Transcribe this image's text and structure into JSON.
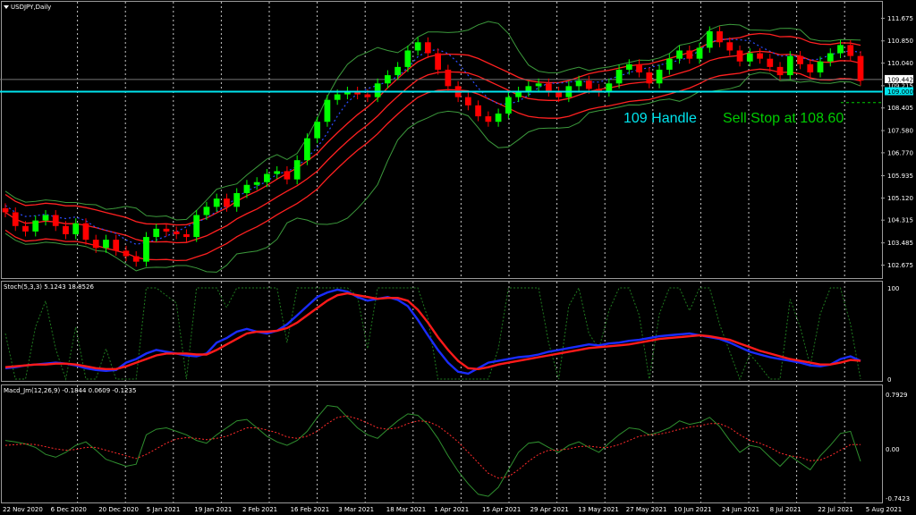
{
  "chart_data": [
    {
      "type": "line",
      "panel": "main",
      "title": "USDJPY,Daily",
      "x_labels": [
        "22 Nov 2020",
        "6 Dec 2020",
        "20 Dec 2020",
        "5 Jan 2021",
        "19 Jan 2021",
        "2 Feb 2021",
        "16 Feb 2021",
        "3 Mar 2021",
        "18 Mar 2021",
        "1 Apr 2021",
        "15 Apr 2021",
        "29 Apr 2021",
        "13 May 2021",
        "27 May 2021",
        "10 Jun 2021",
        "24 Jun 2021",
        "8 Jul 2021",
        "22 Jul 2021",
        "5 Aug 2021"
      ],
      "y_ticks": [
        102.675,
        103.485,
        104.315,
        105.12,
        105.935,
        106.77,
        107.58,
        108.405,
        109.215,
        110.04,
        110.85,
        111.675
      ],
      "ylim": [
        102.3,
        111.95
      ],
      "grid": true,
      "price_labels": {
        "current": "109.442",
        "level": "109.000"
      },
      "level_line": 109.0,
      "stop_line": 108.6,
      "annotations": {
        "handle": "109 Handle",
        "stop": "Sell Stop at 108.60"
      },
      "colors": {
        "up": "#00ff00",
        "down": "#ff0000",
        "level": "#00e5ee",
        "stop": "#00cc00",
        "bands": "#3c9a3c",
        "envelope": "#ff2020",
        "dots": "#2b4cff"
      },
      "series": [
        {
          "values": [
            104.6,
            104.1,
            103.9,
            104.3,
            104.5,
            104.1,
            103.8,
            104.2,
            103.6,
            103.3,
            103.6,
            103.2,
            103.0,
            102.8,
            103.7,
            104.0,
            103.9,
            103.8,
            103.7,
            104.5,
            104.8,
            105.1,
            104.8,
            105.3,
            105.6,
            105.7,
            106.0,
            106.1,
            105.8,
            106.5,
            107.3,
            107.9,
            108.7,
            108.9,
            109.0,
            108.9,
            108.8,
            109.3,
            109.6,
            109.9,
            110.5,
            110.8,
            110.4,
            109.8,
            109.2,
            108.8,
            108.5,
            108.1,
            107.9,
            108.2,
            108.8,
            109.0,
            109.2,
            109.3,
            109.0,
            108.8,
            109.2,
            109.4,
            109.1,
            109.0,
            109.3,
            109.8,
            110.0,
            109.7,
            109.3,
            109.8,
            110.2,
            110.5,
            110.2,
            110.6,
            111.2,
            110.8,
            110.5,
            110.1,
            110.4,
            110.2,
            109.9,
            109.6,
            110.3,
            110.0,
            109.7,
            110.1,
            110.4,
            110.7,
            110.3,
            109.4
          ]
        }
      ]
    },
    {
      "type": "line",
      "panel": "stochastic",
      "title": "Stoch(5,3,3) 5.1243 18.8526",
      "y_ticks": [
        100,
        0
      ],
      "ylim": [
        0,
        100
      ],
      "series": [
        {
          "values": [
            12,
            13,
            15,
            16,
            17,
            18,
            17,
            15,
            12,
            10,
            9,
            10,
            18,
            22,
            28,
            32,
            30,
            28,
            26,
            25,
            28,
            40,
            45,
            52,
            55,
            52,
            50,
            53,
            60,
            70,
            80,
            90,
            95,
            98,
            96,
            90,
            86,
            88,
            90,
            87,
            80,
            65,
            48,
            32,
            18,
            8,
            6,
            12,
            18,
            20,
            22,
            24,
            25,
            27,
            30,
            32,
            34,
            36,
            38,
            37,
            39,
            40,
            42,
            43,
            45,
            47,
            48,
            49,
            50,
            48,
            46,
            44,
            40,
            35,
            30,
            27,
            24,
            22,
            20,
            18,
            15,
            14,
            16,
            22,
            25,
            20
          ]
        },
        {
          "values": [
            13,
            14,
            15,
            16,
            16,
            17,
            17,
            16,
            14,
            12,
            11,
            11,
            14,
            18,
            22,
            26,
            28,
            28,
            28,
            27,
            27,
            32,
            38,
            44,
            50,
            52,
            52,
            53,
            56,
            62,
            70,
            78,
            86,
            92,
            94,
            92,
            90,
            88,
            89,
            89,
            86,
            76,
            62,
            46,
            32,
            20,
            12,
            11,
            13,
            16,
            18,
            20,
            22,
            24,
            26,
            28,
            30,
            32,
            34,
            35,
            36,
            37,
            38,
            40,
            42,
            44,
            45,
            46,
            47,
            48,
            47,
            45,
            43,
            39,
            35,
            31,
            28,
            25,
            22,
            20,
            18,
            16,
            16,
            18,
            21,
            20
          ]
        }
      ]
    },
    {
      "type": "line",
      "panel": "macd",
      "title": "Macd_Jm(12,26,9) -0.1844 0.0609 -0.1235",
      "y_ticks": [
        0.7929,
        0.0,
        -0.7423
      ],
      "ylim": [
        -0.7423,
        0.7929
      ],
      "series": [
        {
          "values": [
            0.12,
            0.1,
            0.07,
            0.02,
            -0.08,
            -0.12,
            -0.05,
            0.05,
            0.1,
            -0.02,
            -0.15,
            -0.2,
            -0.25,
            -0.22,
            0.2,
            0.28,
            0.3,
            0.25,
            0.2,
            0.12,
            0.08,
            0.2,
            0.3,
            0.4,
            0.42,
            0.3,
            0.18,
            0.1,
            0.05,
            0.12,
            0.25,
            0.45,
            0.62,
            0.6,
            0.45,
            0.3,
            0.2,
            0.15,
            0.28,
            0.4,
            0.5,
            0.48,
            0.35,
            0.15,
            -0.1,
            -0.32,
            -0.5,
            -0.65,
            -0.68,
            -0.55,
            -0.3,
            -0.05,
            0.08,
            0.1,
            0.02,
            -0.05,
            0.05,
            0.1,
            0.02,
            -0.05,
            0.08,
            0.2,
            0.3,
            0.28,
            0.2,
            0.24,
            0.3,
            0.4,
            0.35,
            0.38,
            0.45,
            0.32,
            0.12,
            -0.05,
            0.05,
            0.02,
            -0.12,
            -0.25,
            -0.1,
            -0.2,
            -0.3,
            -0.1,
            0.05,
            0.22,
            0.25,
            -0.18
          ]
        },
        {
          "values": [
            0.05,
            0.06,
            0.07,
            0.06,
            0.03,
            0.0,
            -0.02,
            -0.01,
            0.02,
            0.02,
            -0.02,
            -0.06,
            -0.1,
            -0.14,
            -0.08,
            0.0,
            0.08,
            0.14,
            0.16,
            0.15,
            0.13,
            0.15,
            0.18,
            0.24,
            0.3,
            0.3,
            0.27,
            0.23,
            0.17,
            0.15,
            0.18,
            0.25,
            0.36,
            0.45,
            0.47,
            0.43,
            0.37,
            0.3,
            0.28,
            0.3,
            0.36,
            0.4,
            0.39,
            0.33,
            0.22,
            0.1,
            -0.05,
            -0.2,
            -0.35,
            -0.42,
            -0.4,
            -0.3,
            -0.18,
            -0.08,
            -0.02,
            -0.02,
            0.0,
            0.03,
            0.04,
            0.02,
            0.02,
            0.06,
            0.12,
            0.18,
            0.2,
            0.21,
            0.24,
            0.28,
            0.31,
            0.33,
            0.36,
            0.36,
            0.3,
            0.2,
            0.12,
            0.08,
            0.02,
            -0.06,
            -0.1,
            -0.12,
            -0.17,
            -0.16,
            -0.1,
            -0.02,
            0.06,
            0.06
          ]
        }
      ]
    }
  ]
}
